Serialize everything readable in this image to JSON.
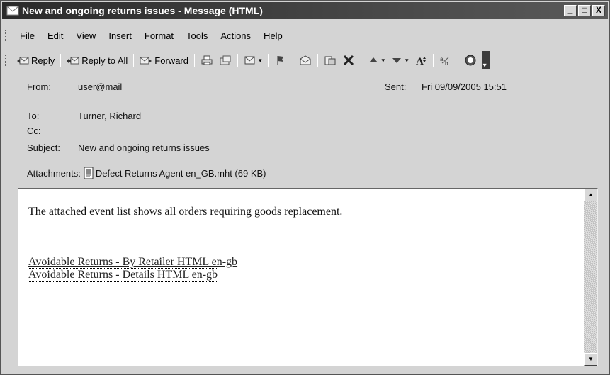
{
  "window": {
    "title": "New and ongoing returns issues - Message (HTML)",
    "minimize": "_",
    "maximize": "□",
    "close": "X"
  },
  "menu": [
    {
      "key": "F",
      "rest": "ile"
    },
    {
      "key": "E",
      "rest": "dit"
    },
    {
      "key": "V",
      "rest": "iew"
    },
    {
      "key": "I",
      "rest": "nsert"
    },
    {
      "pre": "F",
      "key": "o",
      "rest": "rmat"
    },
    {
      "key": "T",
      "rest": "ools"
    },
    {
      "key": "A",
      "rest": "ctions"
    },
    {
      "key": "H",
      "rest": "elp"
    }
  ],
  "toolbar": {
    "reply_key": "R",
    "reply_rest": "eply",
    "reply_all_pre": "Reply to A",
    "reply_all_key": "l",
    "reply_all_rest": "l",
    "forward_pre": "For",
    "forward_key": "w",
    "forward_rest": "ard"
  },
  "header": {
    "from_label": "From:",
    "from_value": "user@mail",
    "sent_label": "Sent:",
    "sent_value": "Fri 09/09/2005 15:51",
    "to_label": "To:",
    "to_value": "Turner, Richard",
    "cc_label": "Cc:",
    "cc_value": "",
    "subject_label": "Subject:",
    "subject_value": "New and ongoing returns issues",
    "attachments_label": "Attachments:",
    "attachment_name": "Defect Returns Agent en_GB.mht (69 KB)"
  },
  "body": {
    "text": "The attached event list shows all orders requiring goods replacement.",
    "link1": "Avoidable Returns - By Retailer HTML en-gb",
    "link2": "Avoidable Returns - Details HTML en-gb"
  }
}
